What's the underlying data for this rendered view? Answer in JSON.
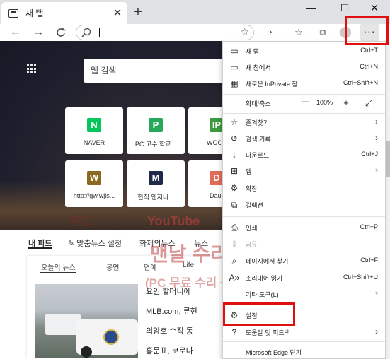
{
  "tab": {
    "title": "새 탭",
    "close": "✕"
  },
  "new_tab_label": "+",
  "window": {
    "minimize": "—",
    "maximize": "☐",
    "close": "✕"
  },
  "toolbar": {
    "more": "···"
  },
  "hero": {
    "search_placeholder": "웹 검색"
  },
  "tiles": [
    {
      "label": "NAVER",
      "logo": "N",
      "color": "#03c75a"
    },
    {
      "label": "PC 고수 학교...",
      "logo": "P",
      "color": "#27a85a"
    },
    {
      "label": "WOO",
      "logo": "IP",
      "color": "#3c9a3c"
    },
    {
      "label": "http://gw.wjis...",
      "logo": "W",
      "color": "#8a6a1e"
    },
    {
      "label": "현직 엔지니...",
      "logo": "M",
      "color": "#1f2a4a"
    },
    {
      "label": "Dau",
      "logo": "D",
      "color": "#e06b5b"
    }
  ],
  "feed": {
    "tabs": [
      "내 피드",
      "맞춤뉴스 설정",
      "화제의뉴스",
      "뉴스"
    ]
  },
  "news": {
    "categories": [
      "오늘의 뉴스",
      "공연",
      "연예",
      "Life"
    ],
    "lines": [
      "요인 할머니에",
      "MLB.com, 류현",
      "의암호 순직 동",
      "홍문표, 코로나"
    ]
  },
  "watermark": {
    "pc": "PC",
    "channel": "YouTube",
    "title": "맨날 수리야",
    "subtitle": "(PC 무료 수리 상담)"
  },
  "menu": {
    "new_tab": {
      "label": "새 탭",
      "shortcut": "Ctrl+T"
    },
    "new_window": {
      "label": "새 창에서",
      "shortcut": "Ctrl+N"
    },
    "new_inprivate": {
      "label": "새로운 InPrivate 창",
      "shortcut": "Ctrl+Shift+N"
    },
    "zoom": {
      "label": "확대/축소",
      "minus": "—",
      "value": "100%",
      "plus": "+",
      "full": "⤢"
    },
    "favorites": {
      "label": "즐겨찾기"
    },
    "history": {
      "label": "검색 기록"
    },
    "downloads": {
      "label": "다운로드",
      "shortcut": "Ctrl+J"
    },
    "apps": {
      "label": "앱"
    },
    "extensions": {
      "label": "확장"
    },
    "collections": {
      "label": "컬렉션"
    },
    "print": {
      "label": "인쇄",
      "shortcut": "Ctrl+P"
    },
    "share": {
      "label": "공유"
    },
    "find": {
      "label": "페이지에서 찾기",
      "shortcut": "Ctrl+F"
    },
    "read_aloud": {
      "label": "소리내어 읽기",
      "shortcut": "Ctrl+Shift+U"
    },
    "more_tools": {
      "label": "기타 도구(L)"
    },
    "settings": {
      "label": "설정"
    },
    "help": {
      "label": "도움말 및 피드백"
    },
    "close": {
      "label": "Microsoft Edge 닫기"
    }
  },
  "colors": {
    "highlight": "#e01010"
  }
}
